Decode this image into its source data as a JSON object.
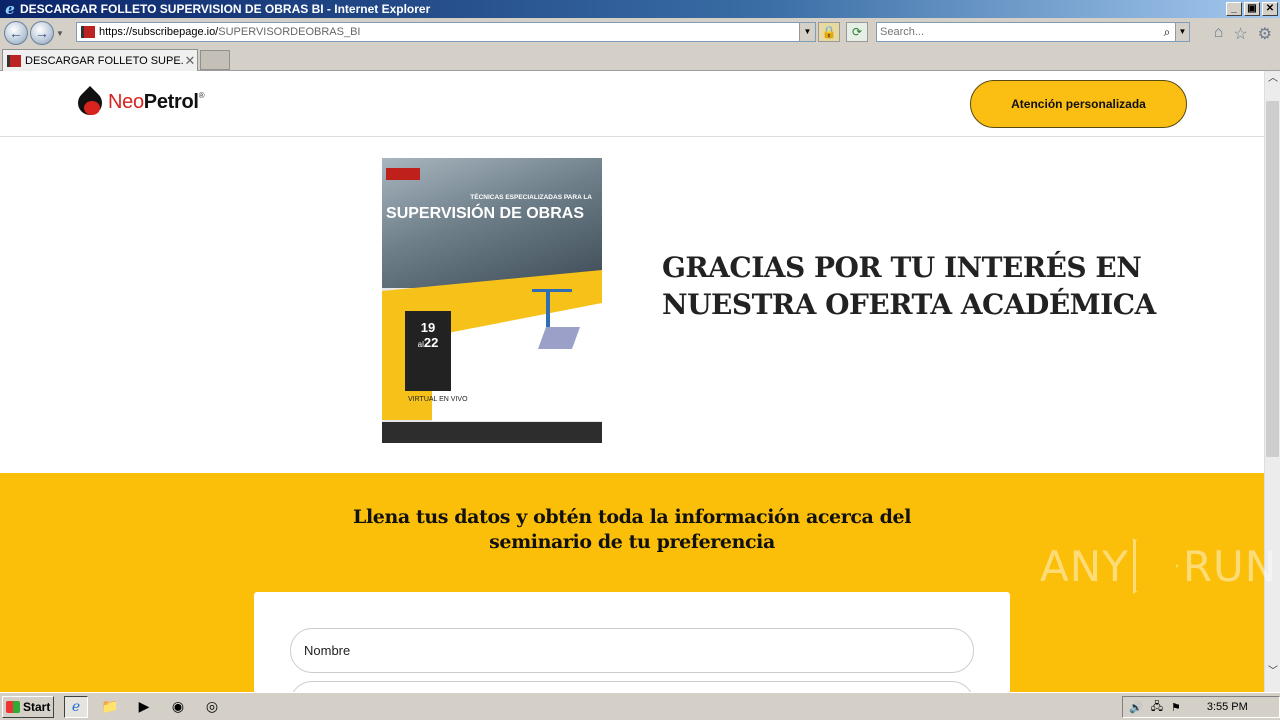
{
  "window": {
    "title": "DESCARGAR FOLLETO SUPERVISION DE OBRAS BI - Internet Explorer",
    "buttons": {
      "minimize": "_",
      "maximize": "▣",
      "close": "✕"
    }
  },
  "navbar": {
    "url_host": "https://subscribepage.io/",
    "url_path": "SUPERVISORDEOBRAS_BI",
    "search_placeholder": "Search..."
  },
  "tabs": [
    {
      "label": "DESCARGAR FOLLETO SUPE...",
      "active": true
    }
  ],
  "site": {
    "logo": {
      "neo": "Neo",
      "petrol": "Petrol",
      "reg": "®"
    },
    "cta_label": "Atención personalizada",
    "brochure": {
      "title_small": "TÉCNICAS ESPECIALIZADAS PARA LA",
      "title_big": "SUPERVISIÓN DE OBRAS",
      "date_start": "19",
      "date_al": "al",
      "date_end": "22",
      "virtual": "VIRTUAL EN VIVO"
    },
    "thanks_heading": "GRACIAS POR TU INTERÉS EN NUESTRA OFERTA ACADÉMICA",
    "form": {
      "heading": "Llena tus datos y obtén toda la información acerca del seminario de tu preferencia",
      "fields": [
        {
          "placeholder": "Nombre"
        },
        {
          "placeholder": ""
        }
      ]
    }
  },
  "watermark": {
    "left": "ANY",
    "right": "RUN"
  },
  "taskbar": {
    "start_label": "Start",
    "clock": "3:55 PM"
  },
  "colors": {
    "accent_yellow": "#fbbf09",
    "brand_red": "#d8231f",
    "title_bar": "#0a246a"
  }
}
